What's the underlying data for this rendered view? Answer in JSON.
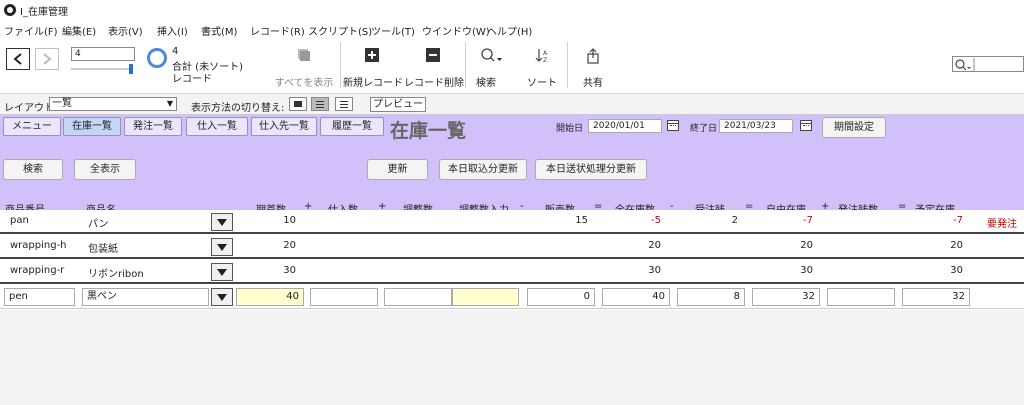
{
  "window": {
    "title": "I_在庫管理"
  },
  "menu": [
    "ファイル(F)",
    "編集(E)",
    "表示(V)",
    "挿入(I)",
    "書式(M)",
    "レコード(R)",
    "スクリプト(S)",
    "ツール(T)",
    "ウインドウ(W)",
    "ヘルプ(H)"
  ],
  "toolbar": {
    "record_value": "4",
    "record_count": "4",
    "sort_status": "合計 (未ソート)",
    "records_label": "レコード",
    "show_all": "すべてを表示",
    "new_record": "新規レコード",
    "delete_record": "レコード削除",
    "search": "検索",
    "sort": "ソート",
    "share": "共有"
  },
  "layoutbar": {
    "layout_label": "レイアウト:",
    "layout_value": "一覧",
    "view_label": "表示方法の切り替え:",
    "preview": "プレビュー"
  },
  "nav_tabs": [
    "メニュー",
    "在庫一覧",
    "発注一覧",
    "仕入一覧",
    "仕入先一覧",
    "履歴一覧"
  ],
  "page_title": "在庫一覧",
  "dates": {
    "start_label": "開始日",
    "start_value": "2020/01/01",
    "end_label": "終了日",
    "end_value": "2021/03/23",
    "period_btn": "期間設定"
  },
  "actions": {
    "search": "検索",
    "show_all": "全表示",
    "update": "更新",
    "today_import": "本日取込分更新",
    "today_send": "本日送状処理分更新"
  },
  "columns": {
    "code": "商品番号",
    "name": "商品名",
    "opening": "期首数",
    "purchase": "仕入数",
    "adjust": "調整数",
    "adjust_input": "調整数入力",
    "sales": "販売数",
    "total_stock": "全在庫数",
    "orders": "受注残",
    "free_stock": "自由在庫",
    "po_remaining": "発注残数",
    "planned_stock": "予定在庫"
  },
  "operators": [
    "+",
    "+",
    "-",
    "=",
    "-",
    "=",
    "+",
    "="
  ],
  "rows": [
    {
      "code": "pan",
      "name": "パン",
      "opening": "10",
      "sales": "15",
      "total": "-5",
      "orders": "2",
      "free": "-7",
      "planned": "-7",
      "flag": "要発注"
    },
    {
      "code": "wrapping-h",
      "name": "包装紙",
      "opening": "20",
      "total": "20",
      "free": "20",
      "planned": "20"
    },
    {
      "code": "wrapping-r",
      "name": "リボンribon",
      "opening": "30",
      "total": "30",
      "free": "30",
      "planned": "30"
    },
    {
      "code": "pen",
      "name": "黒ペン",
      "opening": "40",
      "sales": "0",
      "total": "40",
      "orders": "8",
      "free": "32",
      "planned": "32"
    }
  ],
  "colors": {
    "header_bg": "#d2c0fb",
    "negative": "#d00000",
    "active_tab": "#c2d7f5"
  }
}
